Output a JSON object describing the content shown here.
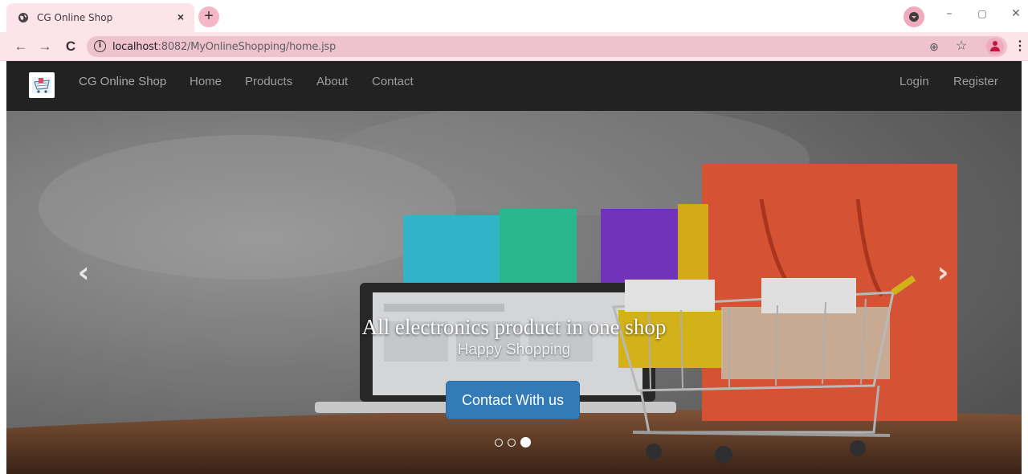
{
  "browser": {
    "tab_title": "CG Online Shop",
    "tab_close": "×",
    "new_tab": "+",
    "url_host": "localhost",
    "url_rest": ":8082/MyOnlineShopping/home.jsp",
    "info_glyph": "i",
    "back": "←",
    "forward": "→",
    "reload": "C",
    "zoom_icon": "⊕",
    "star_icon": "☆",
    "menu": "⋮",
    "minimize": "–",
    "restore": "▢",
    "close": "✕"
  },
  "navbar": {
    "brand": "CG Online Shop",
    "links": [
      "Home",
      "Products",
      "About",
      "Contact"
    ],
    "right_links": [
      "Login",
      "Register"
    ]
  },
  "carousel": {
    "prev": "‹",
    "next": "›",
    "caption_title": "All electronics product in one shop",
    "caption_subtitle": "Happy Shopping",
    "cta_label": "Contact With us",
    "active_slide": 3,
    "slide_count": 3
  },
  "colors": {
    "navbar_bg": "#222222",
    "cta_bg": "#337ab7",
    "tab_bg": "#fde3ea"
  }
}
